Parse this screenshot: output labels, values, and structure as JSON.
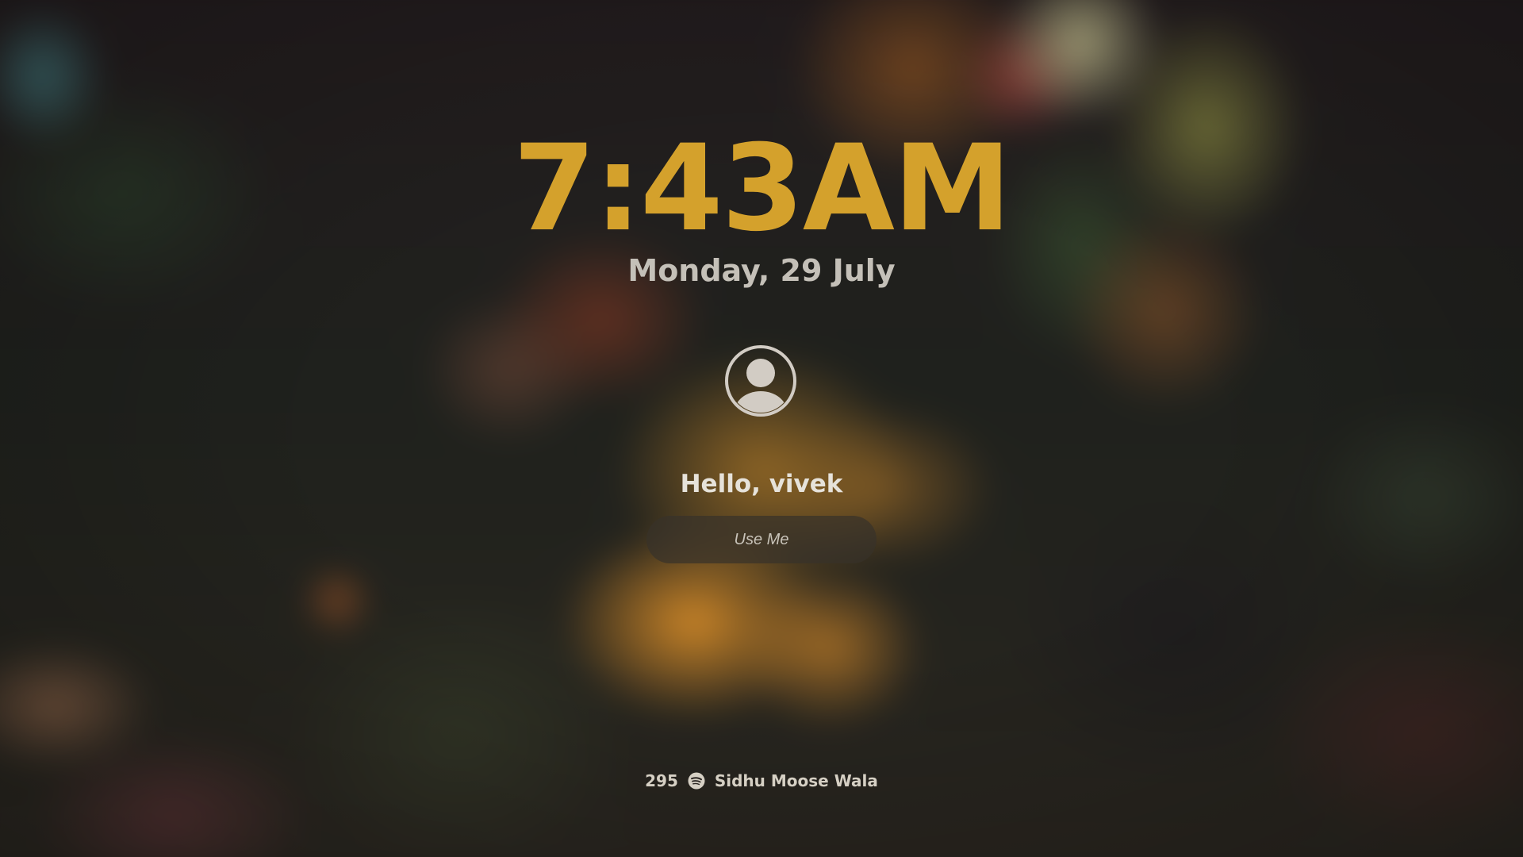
{
  "lockscreen": {
    "time": "7:43AM",
    "date": "Monday, 29 July",
    "greeting": "Hello, vivek",
    "action_button": "Use Me",
    "user_icon": "user-circle-icon"
  },
  "now_playing": {
    "count": "295",
    "icon": "spotify-icon",
    "artist": "Sidhu Moose Wala"
  },
  "colors": {
    "clock": "#d4a12c",
    "date": "#c4c0b8",
    "greeting": "#e6e2da"
  }
}
